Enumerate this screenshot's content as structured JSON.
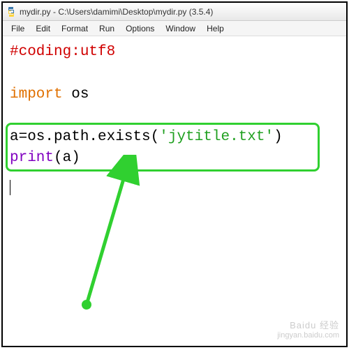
{
  "window": {
    "title": "mydir.py - C:\\Users\\damimi\\Desktop\\mydir.py (3.5.4)"
  },
  "menu": {
    "items": [
      "File",
      "Edit",
      "Format",
      "Run",
      "Options",
      "Window",
      "Help"
    ]
  },
  "code": {
    "line1_comment": "#coding:utf8",
    "line3_import": "import",
    "line3_module": " os",
    "line5_assign": "a=os.path.exists(",
    "line5_string": "'jytitle.txt'",
    "line5_close": ")",
    "line6_func": "print",
    "line6_paren_open": "(",
    "line6_arg": "a",
    "line6_paren_close": ")"
  },
  "watermark": {
    "brand": "Baidu 经验",
    "url": "jingyan.baidu.com"
  }
}
